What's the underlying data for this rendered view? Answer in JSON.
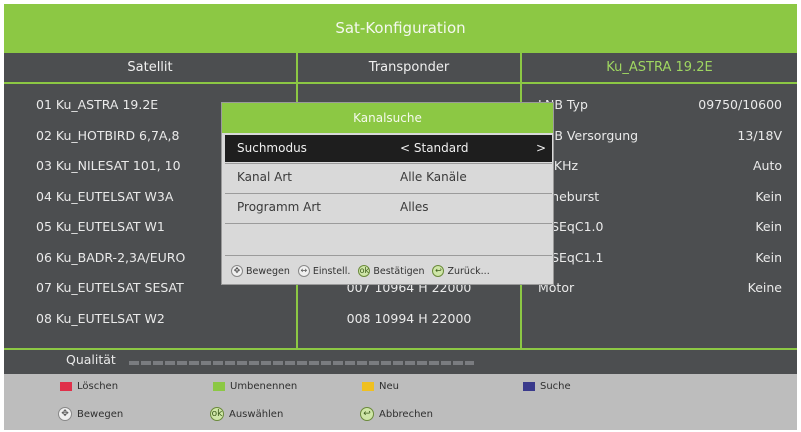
{
  "title": "Sat-Konfiguration",
  "columns": {
    "satellite": "Satellit",
    "transponder": "Transponder",
    "info": "Ku_ASTRA 19.2E"
  },
  "satellites": [
    "01 Ku_ASTRA 19.2E",
    "02 Ku_HOTBIRD 6,7A,8",
    "03 Ku_NILESAT 101, 10",
    "04 Ku_EUTELSAT W3A",
    "05 Ku_EUTELSAT W1",
    "06 Ku_BADR-2,3A/EURO",
    "07 Ku_EUTELSAT SESAT",
    "08 Ku_EUTELSAT W2"
  ],
  "transponders": [
    "007 10964 H 22000",
    "008 10994 H 22000"
  ],
  "info_rows": [
    {
      "key": "LNB Typ",
      "value": "09750/10600"
    },
    {
      "key": "LNB Versorgung",
      "value": "13/18V"
    },
    {
      "key": "22KHz",
      "value": "Auto"
    },
    {
      "key": "Toneburst",
      "value": "Kein"
    },
    {
      "key": "DiSEqC1.0",
      "value": "Kein"
    },
    {
      "key": "DiSEqC1.1",
      "value": "Kein"
    },
    {
      "key": "Motor",
      "value": "Keine"
    }
  ],
  "quality": {
    "label": "Qualität"
  },
  "popup": {
    "title": "Kanalsuche",
    "rows": [
      {
        "key": "Suchmodus",
        "value": "< Standard",
        "arrow": ">"
      },
      {
        "key": "Kanal Art",
        "value": "Alle Kanäle"
      },
      {
        "key": "Programm Art",
        "value": "Alles"
      }
    ],
    "footer": [
      "Bewegen",
      "Einstell.",
      "Bestätigen",
      "Zurück..."
    ]
  },
  "footer": {
    "red": "Löschen",
    "green": "Umbenennen",
    "yellow": "Neu",
    "blue": "Suche",
    "move": "Bewegen",
    "select": "Auswählen",
    "exit": "Abbrechen"
  },
  "colors": {
    "accent": "#8cc844",
    "panel": "#4c4e50",
    "red": "#e0304a",
    "green": "#8cc844",
    "yellow": "#f0c020",
    "blue": "#3a3a8c"
  }
}
